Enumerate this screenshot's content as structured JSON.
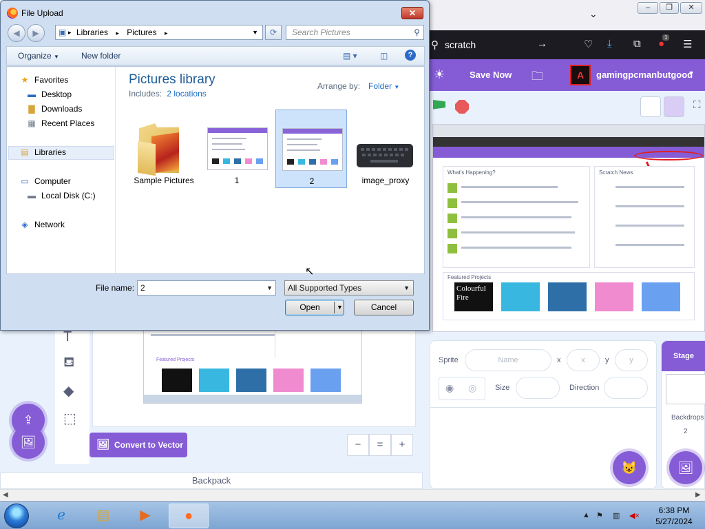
{
  "dialog": {
    "title": "File Upload",
    "close": "✕",
    "breadcrumb": [
      "Libraries",
      "Pictures"
    ],
    "search_placeholder": "Search Pictures",
    "toolbar": {
      "organize": "Organize",
      "new_folder": "New folder"
    },
    "nav": {
      "favorites": "Favorites",
      "desktop": "Desktop",
      "downloads": "Downloads",
      "recent": "Recent Places",
      "libraries": "Libraries",
      "computer": "Computer",
      "local_disk": "Local Disk (C:)",
      "network": "Network"
    },
    "library": {
      "title": "Pictures library",
      "includes_label": "Includes:",
      "includes_link": "2 locations",
      "arrange_label": "Arrange by:",
      "arrange_value": "Folder"
    },
    "files": [
      {
        "name": "Sample Pictures",
        "kind": "folder"
      },
      {
        "name": "1",
        "kind": "screenshot"
      },
      {
        "name": "2",
        "kind": "screenshot",
        "selected": true
      },
      {
        "name": "image_proxy",
        "kind": "keyboard"
      }
    ],
    "file_name_label": "File name:",
    "file_name_value": "2",
    "file_type": "All Supported Types",
    "open_label": "Open",
    "cancel_label": "Cancel"
  },
  "browser": {
    "url_text": "scratch",
    "extension_badge": "1"
  },
  "scratch": {
    "save_now": "Save Now",
    "username": "gamingpcmanbutgood",
    "sprite": {
      "sprite_label": "Sprite",
      "name_placeholder": "Name",
      "x_label": "x",
      "x_placeholder": "x",
      "y_label": "y",
      "y_placeholder": "y",
      "size_label": "Size",
      "direction_label": "Direction"
    },
    "stage": {
      "tab_label": "Stage",
      "backdrops_label": "Backdrops",
      "backdrops_count": "2"
    },
    "stage_screenshot": {
      "happening": "What's Happening?",
      "news": "Scratch News",
      "featured": "Featured Projects",
      "colourful_line1": "Colourful",
      "colourful_line2": "Fire"
    },
    "convert_label": "Convert to Vector",
    "backpack_label": "Backpack",
    "zoom": {
      "out": "−",
      "reset": "=",
      "in": "+"
    }
  },
  "taskbar": {
    "time": "6:38 PM",
    "date": "5/27/2024"
  },
  "colors": {
    "scratch_purple": "#855cd6",
    "dialog_frame": "#cfdef0",
    "title_link_blue": "#1e5d96"
  }
}
